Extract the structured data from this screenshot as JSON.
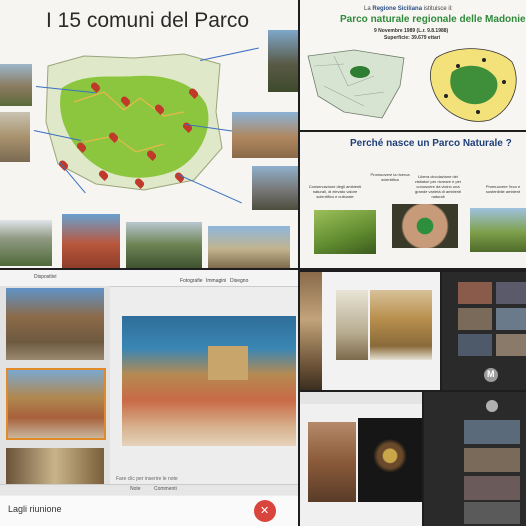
{
  "collage": {
    "p1": {
      "title": "I 15 comuni del Parco"
    },
    "p2": {
      "header_prefix": "La",
      "header_region": "Regione Siciliana",
      "header_suffix": "istituisce il:",
      "title": "Parco naturale regionale delle Madonie",
      "date_line": "9 Novembre 1989 (L.r. 9.8.1988)",
      "surface_line": "Superficie: 39.679 ettari"
    },
    "p3": {
      "title": "Perché nasce un Parco Naturale ?",
      "caption1": "Conservazione degli ambienti naturali, di elevato valore scientifico e culturale",
      "caption2": "Promuovere la ricerca scientifica",
      "caption3": "Libera circolazione dei visitatori per ricreare e per conoscere da vicino una grande varietà di ambienti naturali",
      "caption4": "Promuovere l'eco e sostenibile ambient"
    },
    "p4": {
      "menu": [
        "Dispositivi",
        "Fotografie",
        "Immagini",
        "Disegno"
      ],
      "notes_placeholder": "Fare clic per inserire le note",
      "footer": [
        "Note",
        "Commenti"
      ],
      "meeting_label": "Lagli riunione"
    },
    "p7": {
      "avatar": "M"
    }
  },
  "colors": {
    "background": "#1e1e1e",
    "park_green": "#8cc63f",
    "title_blue": "#2b4f8a",
    "title_green": "#2f8a3a",
    "end_call_red": "#d9453d"
  }
}
